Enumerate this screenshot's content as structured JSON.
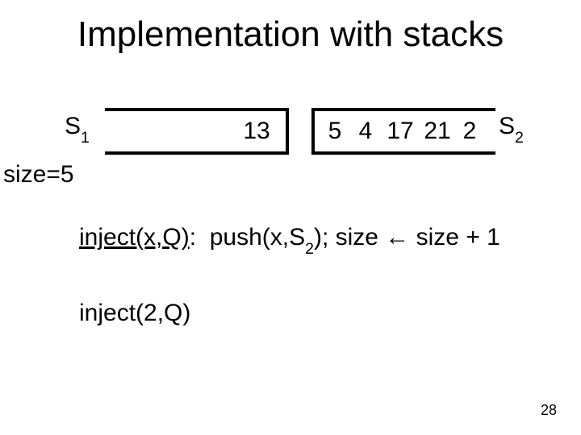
{
  "title": "Implementation with stacks",
  "s1_label_main": "S",
  "s1_label_sub": "1",
  "s2_label_main": "S",
  "s2_label_sub": "2",
  "stack1": {
    "c1": "13"
  },
  "stack2": {
    "c1": "5",
    "c2": "4",
    "c3": "17",
    "c4": "21",
    "c5": "2"
  },
  "size_label": "size=5",
  "rule": {
    "fn": "inject(x,Q)",
    "colon": ":  ",
    "body_pre": "push(x,S",
    "body_sub": "2",
    "body_post": "); size ← size + 1"
  },
  "call": "inject(2,Q)",
  "page_number": "28"
}
